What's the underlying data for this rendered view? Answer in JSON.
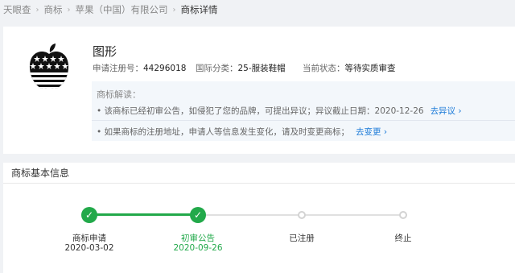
{
  "breadcrumb": [
    "天眼查",
    "商标",
    "苹果（中国）有限公司",
    "商标详情"
  ],
  "trademark": {
    "title": "图形",
    "reg_label": "申请注册号：",
    "reg_no": "44296018",
    "class_label": "国际分类：",
    "class_value": "25-服装鞋帽",
    "status_label": "当前状态：",
    "status_value": "等待实质审查"
  },
  "explain": {
    "title": "商标解读：",
    "line1": "• 该商标已经初审公告，如侵犯了您的品牌，可提出异议；异议截止日期：2020-12-26",
    "link1": "去异议 ›",
    "line2": "• 如果商标的注册地址，申请人等信息发生变化，请及时变更商标；",
    "link2": "去变更 ›"
  },
  "basic": {
    "header": "商标基本信息",
    "steps": [
      {
        "label": "商标申请",
        "date": "2020-03-02",
        "state": "done"
      },
      {
        "label": "初审公告",
        "date": "2020-09-26",
        "state": "current"
      },
      {
        "label": "已注册",
        "date": "",
        "state": "todo"
      },
      {
        "label": "终止",
        "date": "",
        "state": "todo"
      }
    ]
  },
  "colors": {
    "accent": "#22a94a",
    "link": "#1a7ad8"
  },
  "icons": {
    "check": "check-icon",
    "logo": "flag-apple-logo"
  }
}
